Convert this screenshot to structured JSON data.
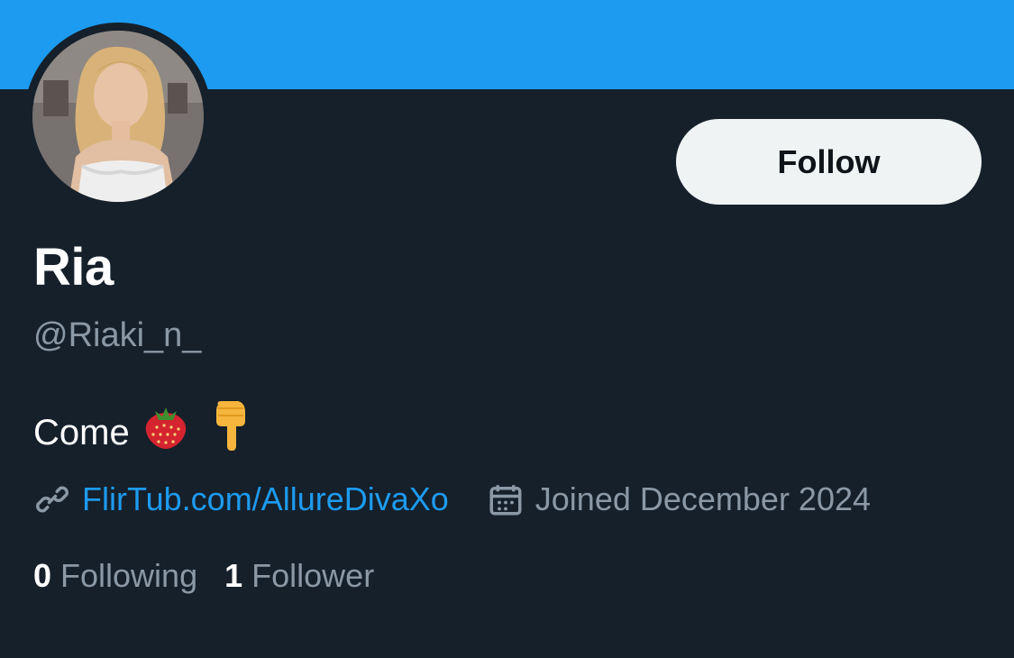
{
  "header": {
    "banner_color": "#1d9bf0"
  },
  "profile": {
    "name": "Ria",
    "handle": "@Riaki_n_",
    "bio": {
      "text": "Come",
      "emojis": [
        "strawberry-emoji",
        "pointing-down-emoji"
      ]
    },
    "link": {
      "icon": "link-icon",
      "text": "FlirTub.com/AllureDivaXo"
    },
    "joined": {
      "icon": "calendar-icon",
      "text": "Joined December 2024"
    },
    "stats": {
      "following_count": "0",
      "following_label": "Following",
      "followers_count": "1",
      "followers_label": "Follower"
    }
  },
  "actions": {
    "follow_label": "Follow"
  },
  "colors": {
    "background": "#15202b",
    "accent": "#1d9bf0",
    "muted_text": "#8b98a5",
    "button_bg": "#eff3f4"
  }
}
